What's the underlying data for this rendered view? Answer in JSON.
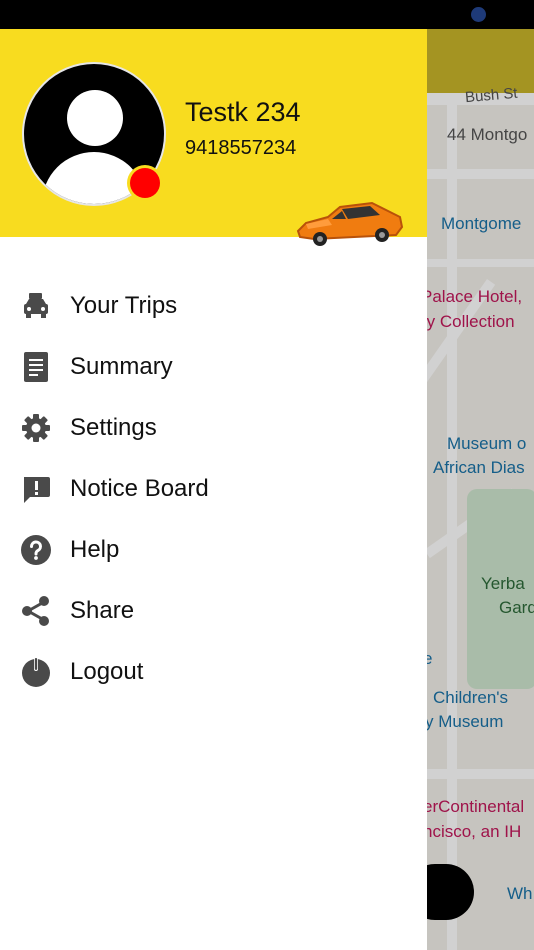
{
  "map": {
    "labels": {
      "bush": "Bush St",
      "montgomery_address": "44 Montgo",
      "montgomery": "Montgome",
      "palace1": "Palace Hotel,",
      "palace2": "ry Collection",
      "museum1": "Museum o",
      "museum2": "African Dias",
      "yerba1": "Yerba",
      "yerba2": "Gard",
      "e": "e",
      "children1": "Children's",
      "children2": "y Museum",
      "interc1": "erContinental",
      "interc2": "ncisco, an IH",
      "wh": "Wh"
    }
  },
  "profile": {
    "name": "Testk 234",
    "phone": "9418557234",
    "status_color": "#ff0000"
  },
  "menu": {
    "items": [
      {
        "label": "Your Trips",
        "icon": "car-icon"
      },
      {
        "label": "Summary",
        "icon": "document-icon"
      },
      {
        "label": "Settings",
        "icon": "gear-icon"
      },
      {
        "label": "Notice Board",
        "icon": "feedback-icon"
      },
      {
        "label": "Help",
        "icon": "help-icon"
      },
      {
        "label": "Share",
        "icon": "share-icon"
      },
      {
        "label": "Logout",
        "icon": "power-icon"
      }
    ]
  },
  "colors": {
    "header_yellow": "#f8dc1f",
    "icon_gray": "#4a4a4a"
  }
}
